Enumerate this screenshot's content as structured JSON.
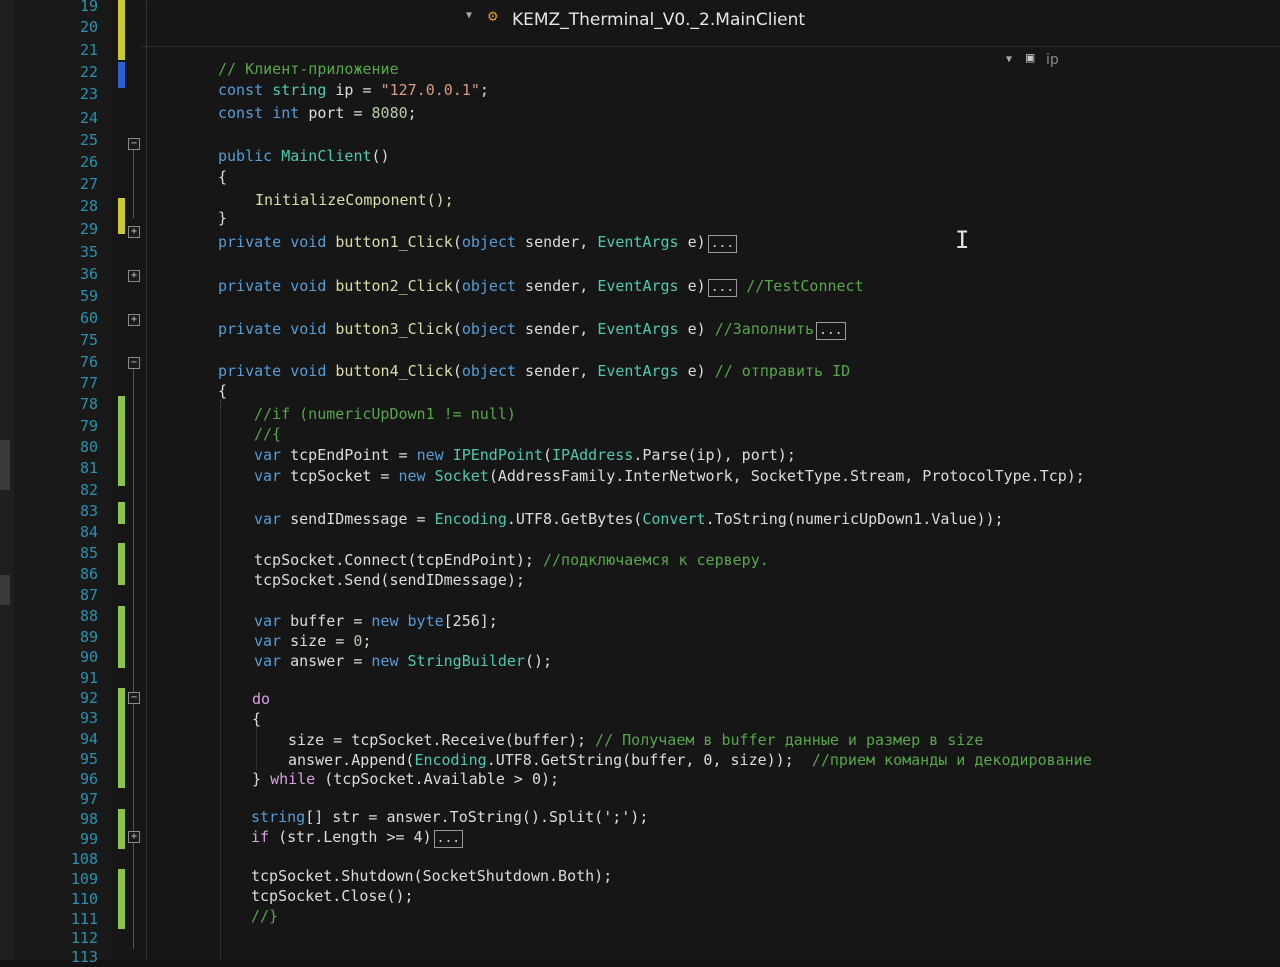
{
  "nav": {
    "class_name": "KEMZ_Therminal_V0._2.MainClient",
    "member_name": "ip"
  },
  "line_numbers": [
    "19",
    "20",
    "21",
    "22",
    "23",
    "24",
    "25",
    "26",
    "27",
    "28",
    "29",
    "35",
    "36",
    "59",
    "60",
    "75",
    "76",
    "77",
    "78",
    "79",
    "80",
    "81",
    "82",
    "83",
    "84",
    "85",
    "86",
    "87",
    "88",
    "89",
    "90",
    "91",
    "92",
    "93",
    "94",
    "95",
    "96",
    "97",
    "98",
    "99",
    "108",
    "109",
    "110",
    "111",
    "112",
    "113"
  ],
  "code": {
    "l22_comment": "// Клиент-приложение",
    "l23_const": "const",
    "l23_type": "string",
    "l23_name": "ip",
    "l23_eq": " = ",
    "l23_value": "\"127.0.0.1\"",
    "l23_semi": ";",
    "l24_const": "const",
    "l24_type": "int",
    "l24_name": "port",
    "l24_eq": " = ",
    "l24_value": "8080",
    "l24_semi": ";",
    "l26_public": "public",
    "l26_ctor": "MainClient",
    "l26_parens": "()",
    "l27_brace": "{",
    "l28_call": "InitializeComponent();",
    "l29_brace": "}",
    "l35_private": "private",
    "l35_void": "void",
    "l35_method": "button1_Click",
    "l35_open": "(",
    "l35_object": "object",
    "l35_sender": " sender, ",
    "l35_eventargs": "EventArgs",
    "l35_e": " e)",
    "l35_collapsed": "...",
    "l36_private": "private",
    "l36_void": "void",
    "l36_method": "button2_Click",
    "l36_open": "(",
    "l36_object": "object",
    "l36_sender": " sender, ",
    "l36_eventargs": "EventArgs",
    "l36_e": " e)",
    "l36_collapsed": "...",
    "l36_comment": "//TestConnect",
    "l59_private": "private",
    "l59_void": "void",
    "l59_method": "button3_Click",
    "l59_open": "(",
    "l59_object": "object",
    "l59_sender": " sender, ",
    "l59_eventargs": "EventArgs",
    "l59_e": " e) ",
    "l59_comment": "//Заполнить",
    "l59_collapsed": "...",
    "l60_private": "private",
    "l60_void": "void",
    "l60_method": "button4_Click",
    "l60_open": "(",
    "l60_object": "object",
    "l60_sender": " sender, ",
    "l60_eventargs": "EventArgs",
    "l60_e": " e) ",
    "l60_comment": "// отправить ID",
    "l75_brace": "{",
    "l76_comment": "//if (numericUpDown1 != null)",
    "l77_comment": "//{",
    "l78_var": "var",
    "l78_name": " tcpEndPoint = ",
    "l78_new": "new",
    "l78_type": "IPEndPoint",
    "l78_open": "(",
    "l78_type2": "IPAddress",
    "l78_rest": ".Parse(ip), port);",
    "l79_var": "var",
    "l79_name": " tcpSocket = ",
    "l79_new": "new",
    "l79_type": "Socket",
    "l79_rest": "(AddressFamily.InterNetwork, SocketType.Stream, ProtocolType.Tcp);",
    "l81_var": "var",
    "l81_name": " sendIDmessage = ",
    "l81_type": "Encoding",
    "l81_mid": ".UTF8.GetBytes(",
    "l81_type2": "Convert",
    "l81_rest": ".ToString(numericUpDown1.Value));",
    "l83_code": "tcpSocket.Connect(tcpEndPoint); ",
    "l83_comment": "//подключаемся к серверу.",
    "l84_code": "tcpSocket.Send(sendIDmessage);",
    "l86_var": "var",
    "l86_name": " buffer = ",
    "l86_new": "new",
    "l86_byte": "byte",
    "l86_rest": "[256];",
    "l87_var": "var",
    "l87_name": " size = ",
    "l87_value": "0",
    "l87_semi": ";",
    "l88_var": "var",
    "l88_name": " answer = ",
    "l88_new": "new",
    "l88_type": "StringBuilder",
    "l88_rest": "();",
    "l90_do": "do",
    "l91_brace": "{",
    "l92_code": "size = tcpSocket.Receive(buffer); ",
    "l92_comment": "// Получаем в buffer данные и размер в size",
    "l93_code": "answer.Append(",
    "l93_type": "Encoding",
    "l93_rest": ".UTF8.GetString(buffer, 0, size));  ",
    "l93_comment": "//прием команды и декодирование",
    "l94_brace": "} ",
    "l94_while": "while",
    "l94_rest": " (tcpSocket.Available > 0);",
    "l96_string": "string",
    "l96_rest": "[] str = answer.ToString().Split(';');",
    "l97_if": "if",
    "l97_rest": " (str.Length >= 4)",
    "l97_collapsed": "...",
    "l108_code": "tcpSocket.Shutdown(SocketShutdown.Both);",
    "l109_code": "tcpSocket.Close();",
    "l110_comment": "//}"
  }
}
